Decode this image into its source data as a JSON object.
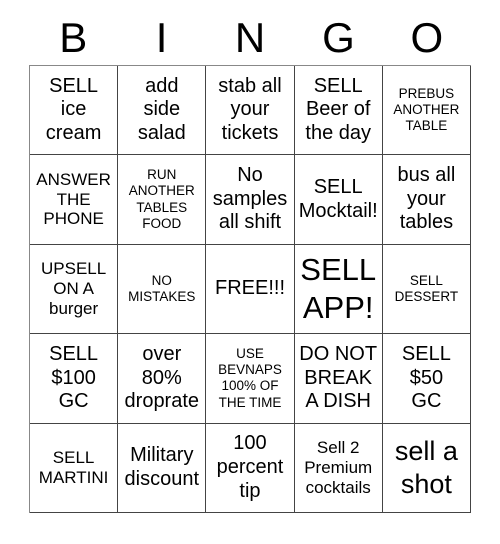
{
  "header": {
    "letters": [
      "B",
      "I",
      "N",
      "G",
      "O"
    ]
  },
  "grid": {
    "rows": 5,
    "columns": 5,
    "border_color": "#444444",
    "background_color": "#ffffff",
    "text_color": "#000000"
  },
  "cells": [
    {
      "text": "SELL\nice\ncream",
      "size": "md"
    },
    {
      "text": "add\nside\nsalad",
      "size": "md"
    },
    {
      "text": "stab all\nyour\ntickets",
      "size": "md"
    },
    {
      "text": "SELL\nBeer of\nthe day",
      "size": "md"
    },
    {
      "text": "PREBUS\nANOTHER\nTABLE",
      "size": "xs"
    },
    {
      "text": "ANSWER\nTHE\nPHONE",
      "size": "sm"
    },
    {
      "text": "RUN\nANOTHER\nTABLES\nFOOD",
      "size": "xs"
    },
    {
      "text": "No\nsamples\nall shift",
      "size": "md"
    },
    {
      "text": "SELL\nMocktail!",
      "size": "md"
    },
    {
      "text": "bus all\nyour\ntables",
      "size": "md"
    },
    {
      "text": "UPSELL\nON A\nburger",
      "size": "sm"
    },
    {
      "text": "NO\nMISTAKES",
      "size": "xs"
    },
    {
      "text": "FREE!!!",
      "size": "md"
    },
    {
      "text": "SELL\nAPP!",
      "size": "xl"
    },
    {
      "text": "SELL\nDESSERT",
      "size": "xs"
    },
    {
      "text": "SELL\n$100\nGC",
      "size": "md"
    },
    {
      "text": "over\n80%\ndroprate",
      "size": "md"
    },
    {
      "text": "USE\nBEVNAPS\n100% OF\nTHE TIME",
      "size": "xs"
    },
    {
      "text": "DO NOT\nBREAK\nA DISH",
      "size": "md"
    },
    {
      "text": "SELL\n$50\nGC",
      "size": "md"
    },
    {
      "text": "SELL\nMARTINI",
      "size": "sm"
    },
    {
      "text": "Military\ndiscount",
      "size": "md"
    },
    {
      "text": "100\npercent\ntip",
      "size": "md"
    },
    {
      "text": "Sell 2\nPremium\ncocktails",
      "size": "sm"
    },
    {
      "text": "sell a\nshot",
      "size": "lg"
    }
  ]
}
